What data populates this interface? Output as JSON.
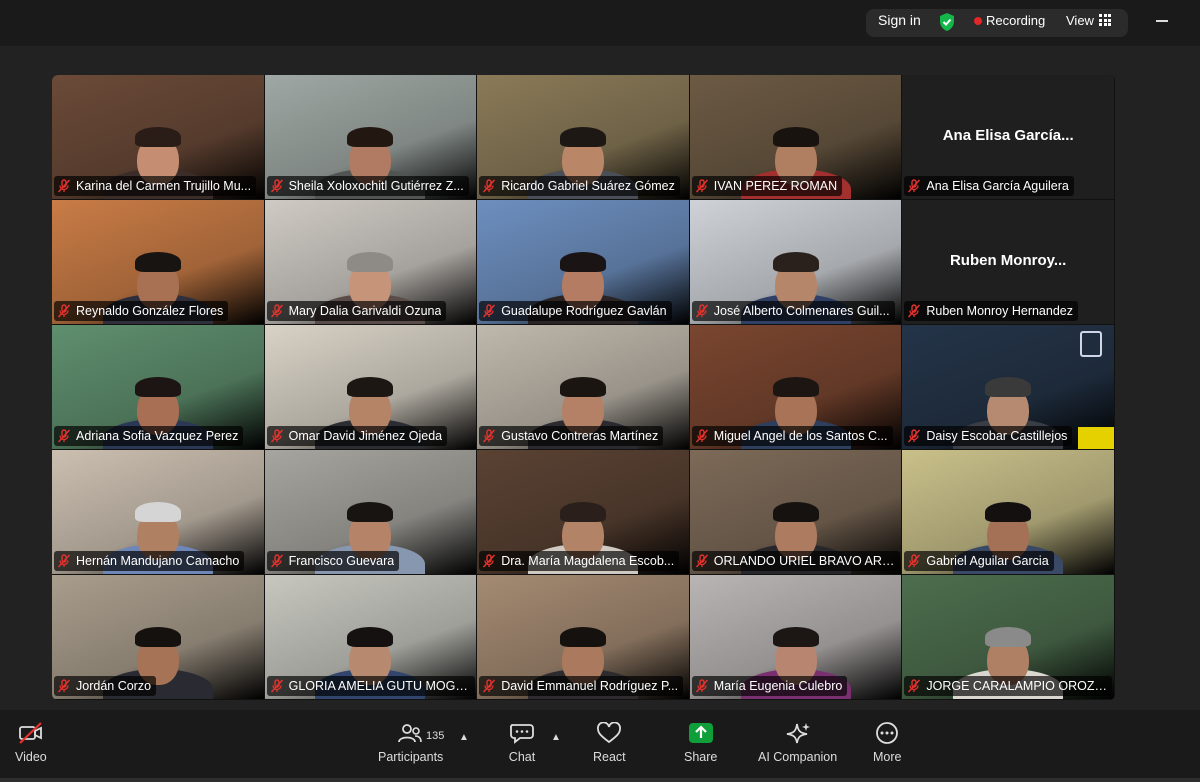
{
  "topbar": {
    "signin_label": "Sign in",
    "recording_label": "Recording",
    "view_label": "View"
  },
  "participants": [
    {
      "name": "Karina del Carmen Trujillo Mu...",
      "bg": "#6b4a38",
      "shirt": "#3b2d2a",
      "skin": "#c58e72",
      "hair": "#2a1c16"
    },
    {
      "name": "Sheila Xoloxochitl Gutiérrez Z...",
      "bg": "#9fa8a4",
      "shirt": "#505554",
      "skin": "#b07b62",
      "hair": "#231712"
    },
    {
      "name": "Ricardo Gabriel Suárez Gómez",
      "bg": "#8a7a58",
      "shirt": "#4a4f57",
      "skin": "#b98668",
      "hair": "#1e1814"
    },
    {
      "name": "IVAN PEREZ ROMAN",
      "bg": "#6c5a44",
      "shirt": "#a2302e",
      "skin": "#b07e60",
      "hair": "#191310"
    },
    {
      "name": "Ana Elisa García Aguilera",
      "blank": true,
      "big": "Ana Elisa García..."
    },
    {
      "name": "Reynaldo González Flores",
      "bg": "#c97c46",
      "shirt": "#2e2f3b",
      "skin": "#a87154",
      "hair": "#181412"
    },
    {
      "name": "Mary Dalia Garivaldi Ozuna",
      "bg": "#cfcac4",
      "shirt": "#5a4c48",
      "skin": "#c69478",
      "hair": "#8e8a86"
    },
    {
      "name": "Guadalupe Rodríguez Gavlán",
      "bg": "#6d8fbf",
      "shirt": "#2a2424",
      "skin": "#b47c63",
      "hair": "#1a1414"
    },
    {
      "name": "José Alberto Colmenares Guil...",
      "bg": "#cfd3d8",
      "shirt": "#2f3f66",
      "skin": "#b5866a",
      "hair": "#2a211c"
    },
    {
      "name": "Ruben Monroy Hernandez",
      "blank": true,
      "big": "Ruben  Monroy..."
    },
    {
      "name": "Adriana Sofia Vazquez Perez",
      "bg": "#5f8f6e",
      "shirt": "#2b3855",
      "skin": "#a86f55",
      "hair": "#1c1513"
    },
    {
      "name": "Omar David Jiménez Ojeda",
      "bg": "#d8d2c6",
      "shirt": "#2b2d33",
      "skin": "#b58466",
      "hair": "#1d1714"
    },
    {
      "name": "Gustavo Contreras Martínez",
      "bg": "#bfb8ac",
      "shirt": "#2c2a2e",
      "skin": "#b48166",
      "hair": "#1b1512"
    },
    {
      "name": "Miguel Angel de los Santos C...",
      "bg": "#7a4630",
      "shirt": "#2e3f5e",
      "skin": "#a87356",
      "hair": "#1d1512"
    },
    {
      "name": "Daisy Escobar Castillejos",
      "bg": "#243448",
      "shirt": "#3a3d44",
      "skin": "#b58a70",
      "hair": "#3a3a3a",
      "logo": true
    },
    {
      "name": "Hernán Mandujano Camacho",
      "bg": "#cbbfb0",
      "shirt": "#6f86b8",
      "skin": "#b08062",
      "hair": "#d5d5d5"
    },
    {
      "name": "Francisco Guevara",
      "bg": "#a6a59f",
      "shirt": "#8797b0",
      "skin": "#b58468",
      "hair": "#181412"
    },
    {
      "name": "Dra. María Magdalena Escob...",
      "bg": "#5a4233",
      "shirt": "#cfc9c2",
      "skin": "#b38367",
      "hair": "#2a1f1a"
    },
    {
      "name": "ORLANDO URIEL BRAVO ARG...",
      "bg": "#7d6a58",
      "shirt": "#27262a",
      "skin": "#ad7b60",
      "hair": "#161210"
    },
    {
      "name": "Gabriel Aguilar Garcia",
      "bg": "#c9c08a",
      "shirt": "#3a4a66",
      "skin": "#a57156",
      "hair": "#141010"
    },
    {
      "name": "Jordán Corzo",
      "bg": "#a99d8c",
      "shirt": "#2a2a33",
      "skin": "#a67356",
      "hair": "#15110f"
    },
    {
      "name": "GLORIA AMELIA GUTU MOGU...",
      "bg": "#c7c7c0",
      "shirt": "#31456d",
      "skin": "#b78a70",
      "hair": "#151111"
    },
    {
      "name": "David Emmanuel Rodríguez P...",
      "bg": "#a48a72",
      "shirt": "#2d2b2e",
      "skin": "#ab7a5e",
      "hair": "#15110f"
    },
    {
      "name": "María Eugenia Culebro",
      "bg": "#b9b5b4",
      "shirt": "#7a2f70",
      "skin": "#b88670",
      "hair": "#1c1614"
    },
    {
      "name": "JORGE CARALAMPIO OROZC...",
      "bg": "#4d6e4e",
      "shirt": "#d9d7cf",
      "skin": "#b08064",
      "hair": "#8a8a8a"
    }
  ],
  "toolbar": {
    "video_label": "Video",
    "participants_label": "Participants",
    "participants_count": "135",
    "chat_label": "Chat",
    "react_label": "React",
    "share_label": "Share",
    "ai_label": "AI Companion",
    "more_label": "More"
  },
  "colors": {
    "recording": "#e02828",
    "share_green": "#0e9f3a",
    "shield_green": "#14b84a",
    "mic_off_red": "#e5322d"
  }
}
